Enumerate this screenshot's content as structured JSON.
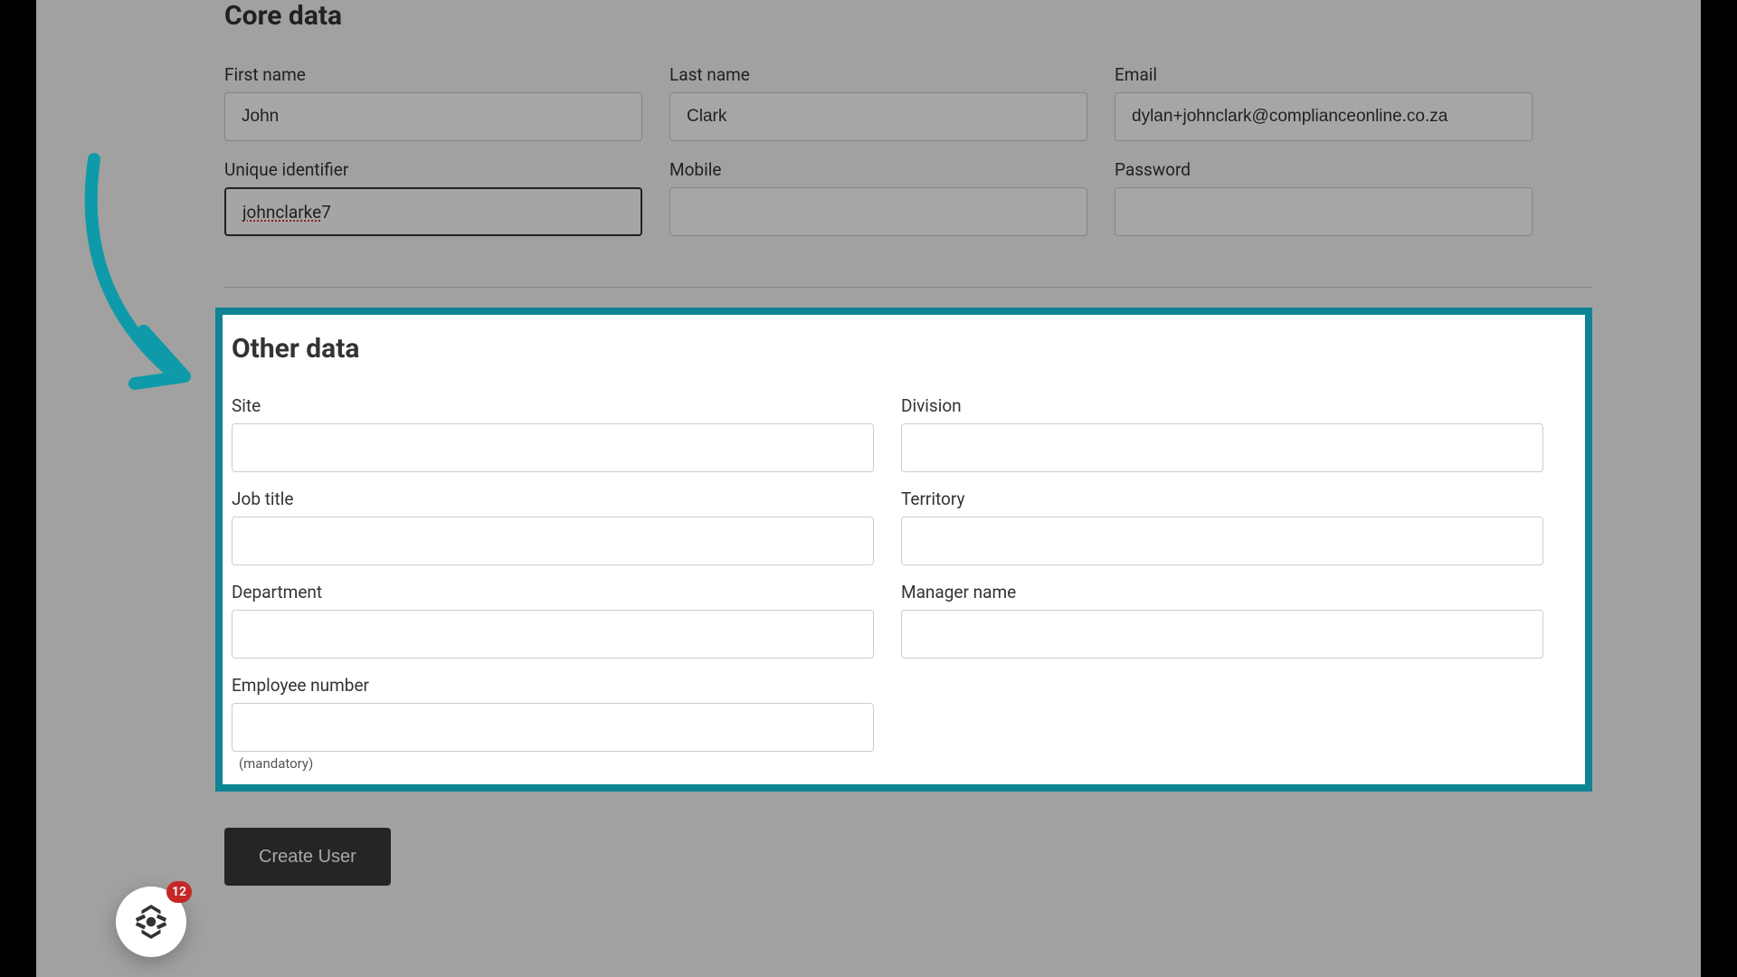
{
  "core": {
    "title": "Core data",
    "fields": {
      "first_name": {
        "label": "First name",
        "value": "John"
      },
      "last_name": {
        "label": "Last name",
        "value": "Clark"
      },
      "email": {
        "label": "Email",
        "value": "dylan+johnclark@complianceonline.co.za"
      },
      "unique_id": {
        "label": "Unique identifier",
        "value_spell": "johnclarke",
        "value_tail": "7"
      },
      "mobile": {
        "label": "Mobile",
        "value": ""
      },
      "password": {
        "label": "Password",
        "value": ""
      }
    }
  },
  "other": {
    "title": "Other data",
    "fields": {
      "site": {
        "label": "Site"
      },
      "division": {
        "label": "Division"
      },
      "job_title": {
        "label": "Job title"
      },
      "territory": {
        "label": "Territory"
      },
      "department": {
        "label": "Department"
      },
      "manager_name": {
        "label": "Manager name"
      },
      "employee_number": {
        "label": "Employee number",
        "hint": "(mandatory)"
      }
    }
  },
  "actions": {
    "create_user": "Create User"
  },
  "widget": {
    "badge": "12"
  },
  "colors": {
    "highlight_border": "#0e8494",
    "arrow": "#0e9aa9",
    "badge": "#c62828"
  }
}
